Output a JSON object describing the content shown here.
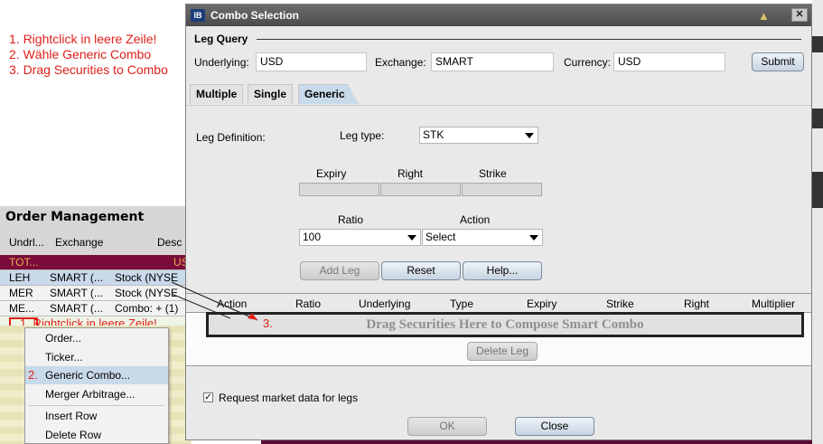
{
  "instructions": {
    "step1": "1. Rightclick in leere Zeile!",
    "step2": "2. Wähle Generic Combo",
    "step3": "3. Drag Securities to Combo"
  },
  "order_management": {
    "title": "Order Management",
    "columns": [
      "Undrl...",
      "Exchange",
      "Desc"
    ],
    "rows": [
      {
        "undrl": "TOT...",
        "exchange": "",
        "desc": "US"
      },
      {
        "undrl": "LEH",
        "exchange": "SMART (...",
        "desc": "Stock (NYSE"
      },
      {
        "undrl": "MER",
        "exchange": "SMART (...",
        "desc": "Stock (NYSE"
      },
      {
        "undrl": "ME...",
        "exchange": "SMART (...",
        "desc": "Combo:  + (1)"
      }
    ],
    "empty_row_note": "1. Rightclick in leere Zeile!"
  },
  "context_menu": {
    "items": [
      "Order...",
      "Ticker...",
      "Generic Combo...",
      "Merger Arbitrage...",
      "Insert Row",
      "Delete Row"
    ],
    "active_index": 2,
    "note": "2."
  },
  "dialog": {
    "logo": "IB",
    "title": "Combo Selection",
    "leg_query_label": "Leg Query",
    "underlying_label": "Underlying:",
    "underlying_value": "USD",
    "exchange_label": "Exchange:",
    "exchange_value": "SMART",
    "currency_label": "Currency:",
    "currency_value": "USD",
    "submit_label": "Submit",
    "tabs": [
      "Multiple",
      "Single",
      "Generic"
    ],
    "active_tab": "Generic",
    "leg_definition_label": "Leg Definition:",
    "leg_type_label": "Leg type:",
    "leg_type_value": "STK",
    "expiry_label": "Expiry",
    "right_label": "Right",
    "strike_label": "Strike",
    "ratio_label": "Ratio",
    "ratio_value": "100",
    "action_label": "Action",
    "action_value": "Select",
    "add_leg_label": "Add Leg",
    "reset_label": "Reset",
    "help_label": "Help...",
    "grid_columns": [
      "Action",
      "Ratio",
      "Underlying",
      "Type",
      "Expiry",
      "Strike",
      "Right",
      "Multiplier"
    ],
    "drop_text": "Drag Securities Here to Compose Smart Combo",
    "drop_note": "3.",
    "delete_leg_label": "Delete Leg",
    "request_market_data_label": "Request market data for legs",
    "request_market_data_checked": true,
    "ok_label": "OK",
    "close_label": "Close"
  }
}
